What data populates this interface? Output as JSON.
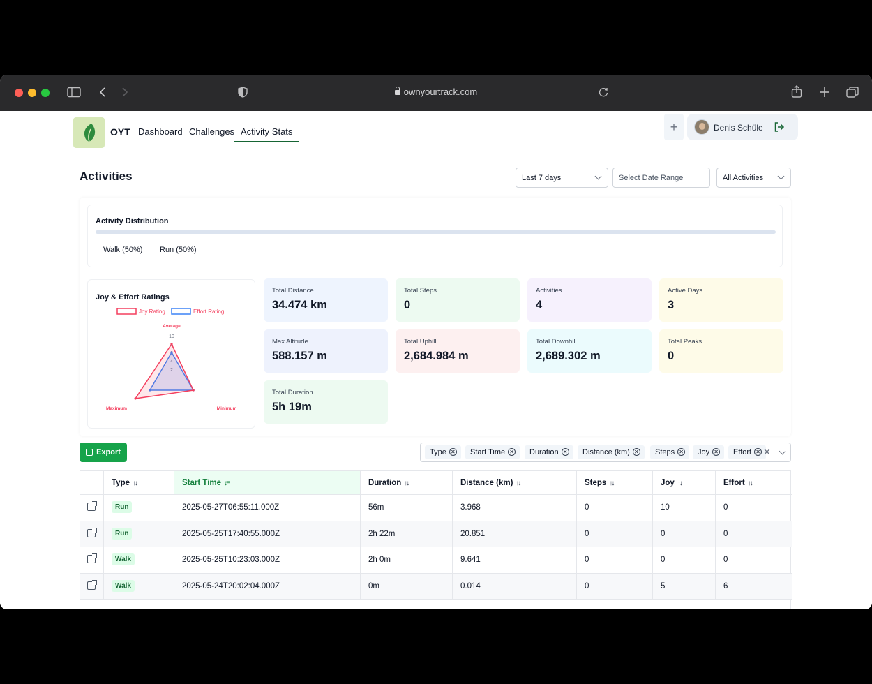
{
  "browser": {
    "url": "ownyourtrack.com"
  },
  "header": {
    "brand": "OYT",
    "nav": [
      "Dashboard",
      "Challenges",
      "Activity Stats"
    ],
    "active_nav": "Activity Stats",
    "user_name": "Denis Schüle"
  },
  "page": {
    "title": "Activities",
    "filters": {
      "period": "Last 7 days",
      "date_range_placeholder": "Select Date Range",
      "activity_type": "All Activities"
    }
  },
  "distribution": {
    "title": "Activity Distribution",
    "legend": [
      "Walk (50%)",
      "Run (50%)"
    ]
  },
  "ratings": {
    "title": "Joy & Effort Ratings",
    "legend": [
      "Joy Rating",
      "Effort Rating"
    ],
    "axes": [
      "Average",
      "Minimum",
      "Maximum"
    ],
    "ticks": [
      "10",
      "8",
      "6",
      "4",
      "2"
    ],
    "scale_max": 10,
    "joy": {
      "Average": 8,
      "Minimum": 6,
      "Maximum": 10
    },
    "effort": {
      "Average": 6,
      "Minimum": 6,
      "Maximum": 6
    },
    "colors": {
      "joy": "#f43f5e",
      "effort": "#3b82f6"
    }
  },
  "stats": [
    {
      "label": "Total Distance",
      "value": "34.474 km",
      "color": "#eef4fe"
    },
    {
      "label": "Total Steps",
      "value": "0",
      "color": "#edfaf1"
    },
    {
      "label": "Activities",
      "value": "4",
      "color": "#f6f1fd"
    },
    {
      "label": "Active Days",
      "value": "3",
      "color": "#fefbe8"
    },
    {
      "label": "Max Altitude",
      "value": "588.157 m",
      "color": "#eef2fd"
    },
    {
      "label": "Total Uphill",
      "value": "2,684.984 m",
      "color": "#fdf0f0"
    },
    {
      "label": "Total Downhill",
      "value": "2,689.302 m",
      "color": "#ebfbfd"
    },
    {
      "label": "Total Peaks",
      "value": "0",
      "color": "#fefbe8"
    },
    {
      "label": "Total Duration",
      "value": "5h 19m",
      "color": "#edfaf1"
    }
  ],
  "toolbar": {
    "export_label": "Export",
    "columns": [
      "Type",
      "Start Time",
      "Duration",
      "Distance (km)",
      "Steps",
      "Joy",
      "Effort"
    ]
  },
  "table": {
    "headers": [
      "Type",
      "Start Time",
      "Duration",
      "Distance (km)",
      "Steps",
      "Joy",
      "Effort"
    ],
    "sorted_column": "Start Time",
    "rows": [
      [
        "Run",
        "2025-05-27T06:55:11.000Z",
        "56m",
        "3.968",
        "0",
        "10",
        "0"
      ],
      [
        "Run",
        "2025-05-25T17:40:55.000Z",
        "2h 22m",
        "20.851",
        "0",
        "0",
        "0"
      ],
      [
        "Walk",
        "2025-05-25T10:23:03.000Z",
        "2h 0m",
        "9.641",
        "0",
        "0",
        "0"
      ],
      [
        "Walk",
        "2025-05-24T20:02:04.000Z",
        "0m",
        "0.014",
        "0",
        "5",
        "6"
      ]
    ]
  }
}
